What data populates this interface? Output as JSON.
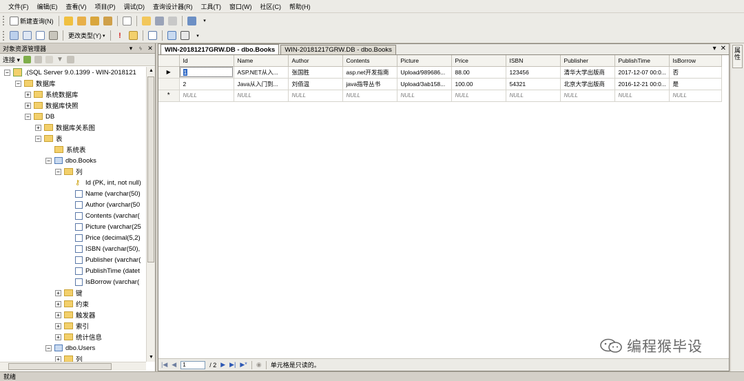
{
  "menu": [
    "文件(F)",
    "编辑(E)",
    "查看(V)",
    "项目(P)",
    "调试(D)",
    "查询设计器(R)",
    "工具(T)",
    "窗口(W)",
    "社区(C)",
    "帮助(H)"
  ],
  "toolbar": {
    "new_query": "新建查询(N)",
    "change_type": "更改类型(Y)"
  },
  "explorer": {
    "title": "对象资源管理器",
    "connect": "连接",
    "tree": [
      "(SQL Server 9.0.1399 - WIN-2018121",
      "数据库",
      "系统数据库",
      "数据库快照",
      "DB",
      "数据库关系图",
      "表",
      "系统表",
      "dbo.Books",
      "列",
      "Id (PK, int, not null)",
      "Name (varchar(50)",
      "Author (varchar(50",
      "Contents (varchar(",
      "Picture (varchar(25",
      "Price (decimal(5,2)",
      "ISBN (varchar(50),",
      "Publisher (varchar(",
      "PublishTime (datet",
      "IsBorrow (varchar(",
      "键",
      "约束",
      "触发器",
      "索引",
      "统计信息",
      "dbo.Users",
      "列"
    ]
  },
  "tabs": [
    "WIN-20181217GRW.DB - dbo.Books",
    "WIN-20181217GRW.DB - dbo.Books"
  ],
  "grid": {
    "columns": [
      "Id",
      "Name",
      "Author",
      "Contents",
      "Picture",
      "Price",
      "ISBN",
      "Publisher",
      "PublishTime",
      "IsBorrow"
    ],
    "rows": [
      [
        "1",
        "ASP.NET从入...",
        "张国胜",
        "asp.net开发指南",
        "Upload/989686...",
        "88.00",
        "123456",
        "清华大学出版商",
        "2017-12-07 00:0...",
        "否"
      ],
      [
        "2",
        "Java从入门到...",
        "刘佰温",
        "java指导丛书",
        "Upload/3ab158...",
        "100.00",
        "54321",
        "北京大学出版商",
        "2016-12-21 00:0...",
        "是"
      ]
    ],
    "null_label": "NULL",
    "row_marker": "▶",
    "new_marker": "*"
  },
  "navigator": {
    "page": "1",
    "total": "/ 2",
    "message": "单元格是只读的。"
  },
  "right_panel": "属性",
  "status": "就绪",
  "watermark": "编程猴毕设"
}
